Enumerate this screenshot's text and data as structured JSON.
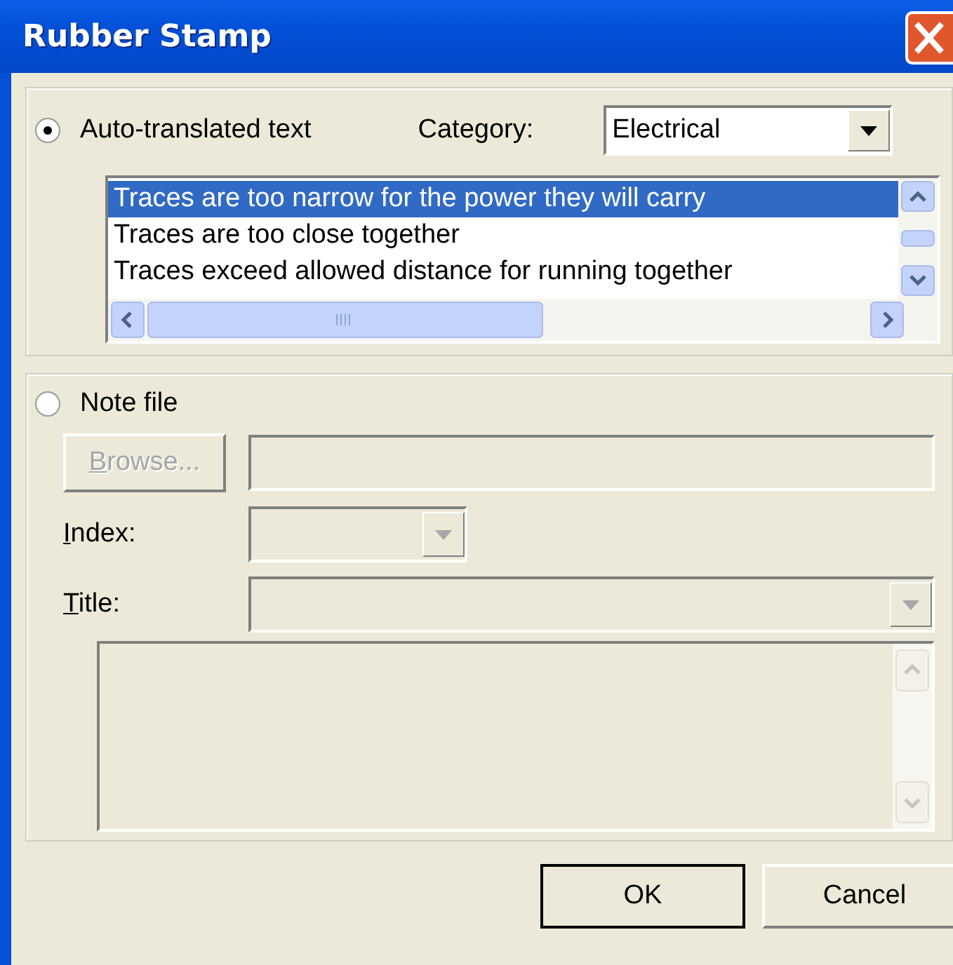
{
  "window": {
    "title": "Rubber Stamp"
  },
  "auto_section": {
    "radio": {
      "label": "Auto-translated text",
      "selected": true
    },
    "category_label": "Category:",
    "category": {
      "value": "Electrical"
    },
    "list": [
      {
        "text": "Traces are too narrow for the power they will carry",
        "selected": true
      },
      {
        "text": "Traces are too close together",
        "selected": false
      },
      {
        "text": "Traces exceed allowed distance for running together",
        "selected": false
      }
    ]
  },
  "note_section": {
    "radio": {
      "label": "Note file",
      "selected": false
    },
    "browse_button": {
      "label": "Browse...",
      "underline_first": true,
      "disabled": true
    },
    "file_field": {
      "disabled": true
    },
    "index": {
      "label": "Index:",
      "underline_first": true,
      "disabled": true
    },
    "title": {
      "label": "Title:",
      "underline_first": true,
      "disabled": true
    },
    "note_text": {
      "disabled": true
    }
  },
  "buttons": [
    {
      "label": "OK",
      "default": true
    },
    {
      "label": "Cancel",
      "default": false
    }
  ]
}
